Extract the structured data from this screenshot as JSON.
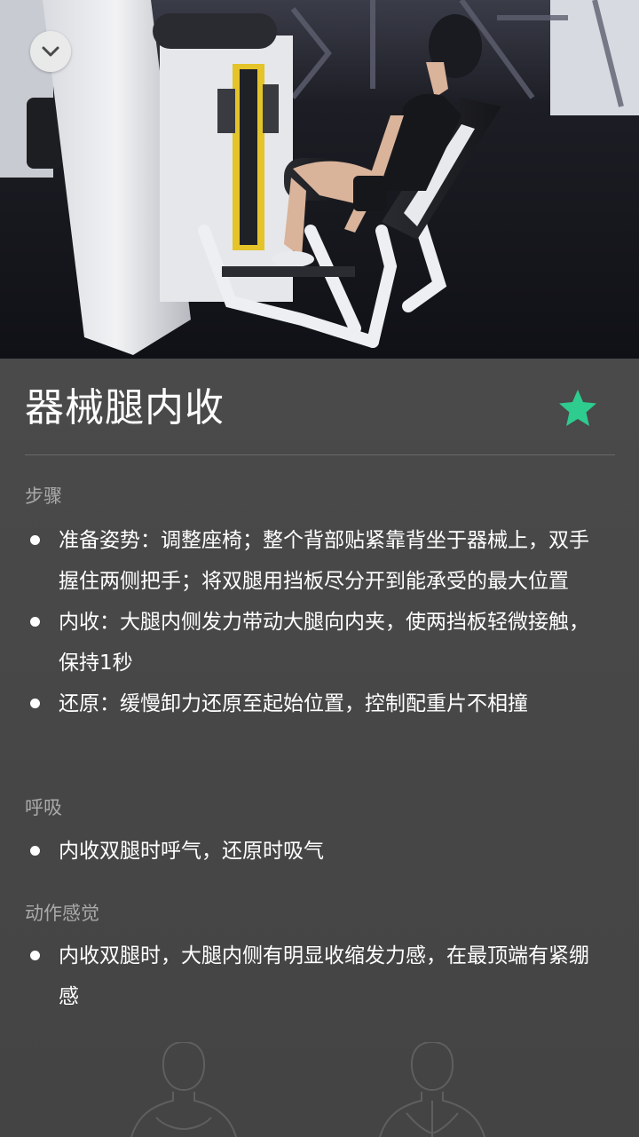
{
  "media": {
    "collapse_icon": "chevron-down-icon"
  },
  "exercise": {
    "title": "器械腿内收",
    "favorite_icon": "star-icon",
    "favorite_color": "#2ecc8f",
    "favorited": true
  },
  "sections": [
    {
      "title": "步骤",
      "items": [
        "准备姿势：调整座椅；整个背部贴紧靠背坐于器械上，双手握住两侧把手；将双腿用挡板尽分开到能承受的最大位置",
        "内收：大腿内侧发力带动大腿向内夹，使两挡板轻微接触，保持1秒",
        "还原：缓慢卸力还原至起始位置，控制配重片不相撞"
      ]
    },
    {
      "title": "呼吸",
      "items": [
        "内收双腿时呼气，还原时吸气"
      ]
    },
    {
      "title": "动作感觉",
      "items": [
        "内收双腿时，大腿内侧有明显收缩发力感，在最顶端有紧绷感"
      ]
    }
  ]
}
